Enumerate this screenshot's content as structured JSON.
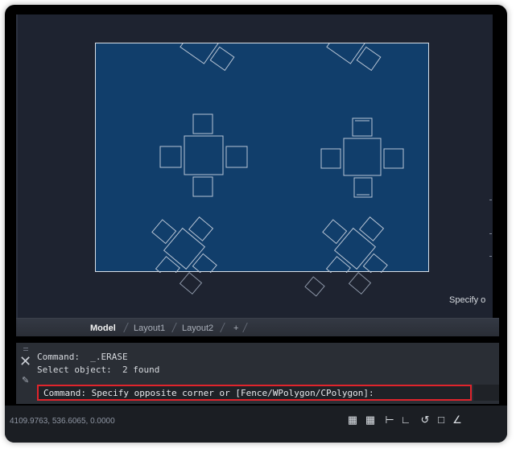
{
  "viewport": {
    "cursor_tooltip": "Specify o"
  },
  "layout_tabs": {
    "items": [
      {
        "label": "Model",
        "active": true
      },
      {
        "label": "Layout1",
        "active": false
      },
      {
        "label": "Layout2",
        "active": false
      }
    ],
    "add_label": "+"
  },
  "command_panel": {
    "history": [
      "Command:  _.ERASE",
      "Select object:  2 found"
    ],
    "prompt": "Command: Specify opposite corner or [Fence/WPolygon/CPolygon]:"
  },
  "status_bar": {
    "coordinates": "4109.9763, 536.6065, 0.0000",
    "icons": [
      "grid-icon",
      "snap-grid-icon",
      "infer-icon",
      "ortho-icon",
      "polar-icon",
      "object-snap-icon",
      "isodraft-icon"
    ]
  },
  "colors": {
    "canvas": "#1e2330",
    "selection_fill": "#113e6b",
    "highlight": "#e0242c"
  }
}
